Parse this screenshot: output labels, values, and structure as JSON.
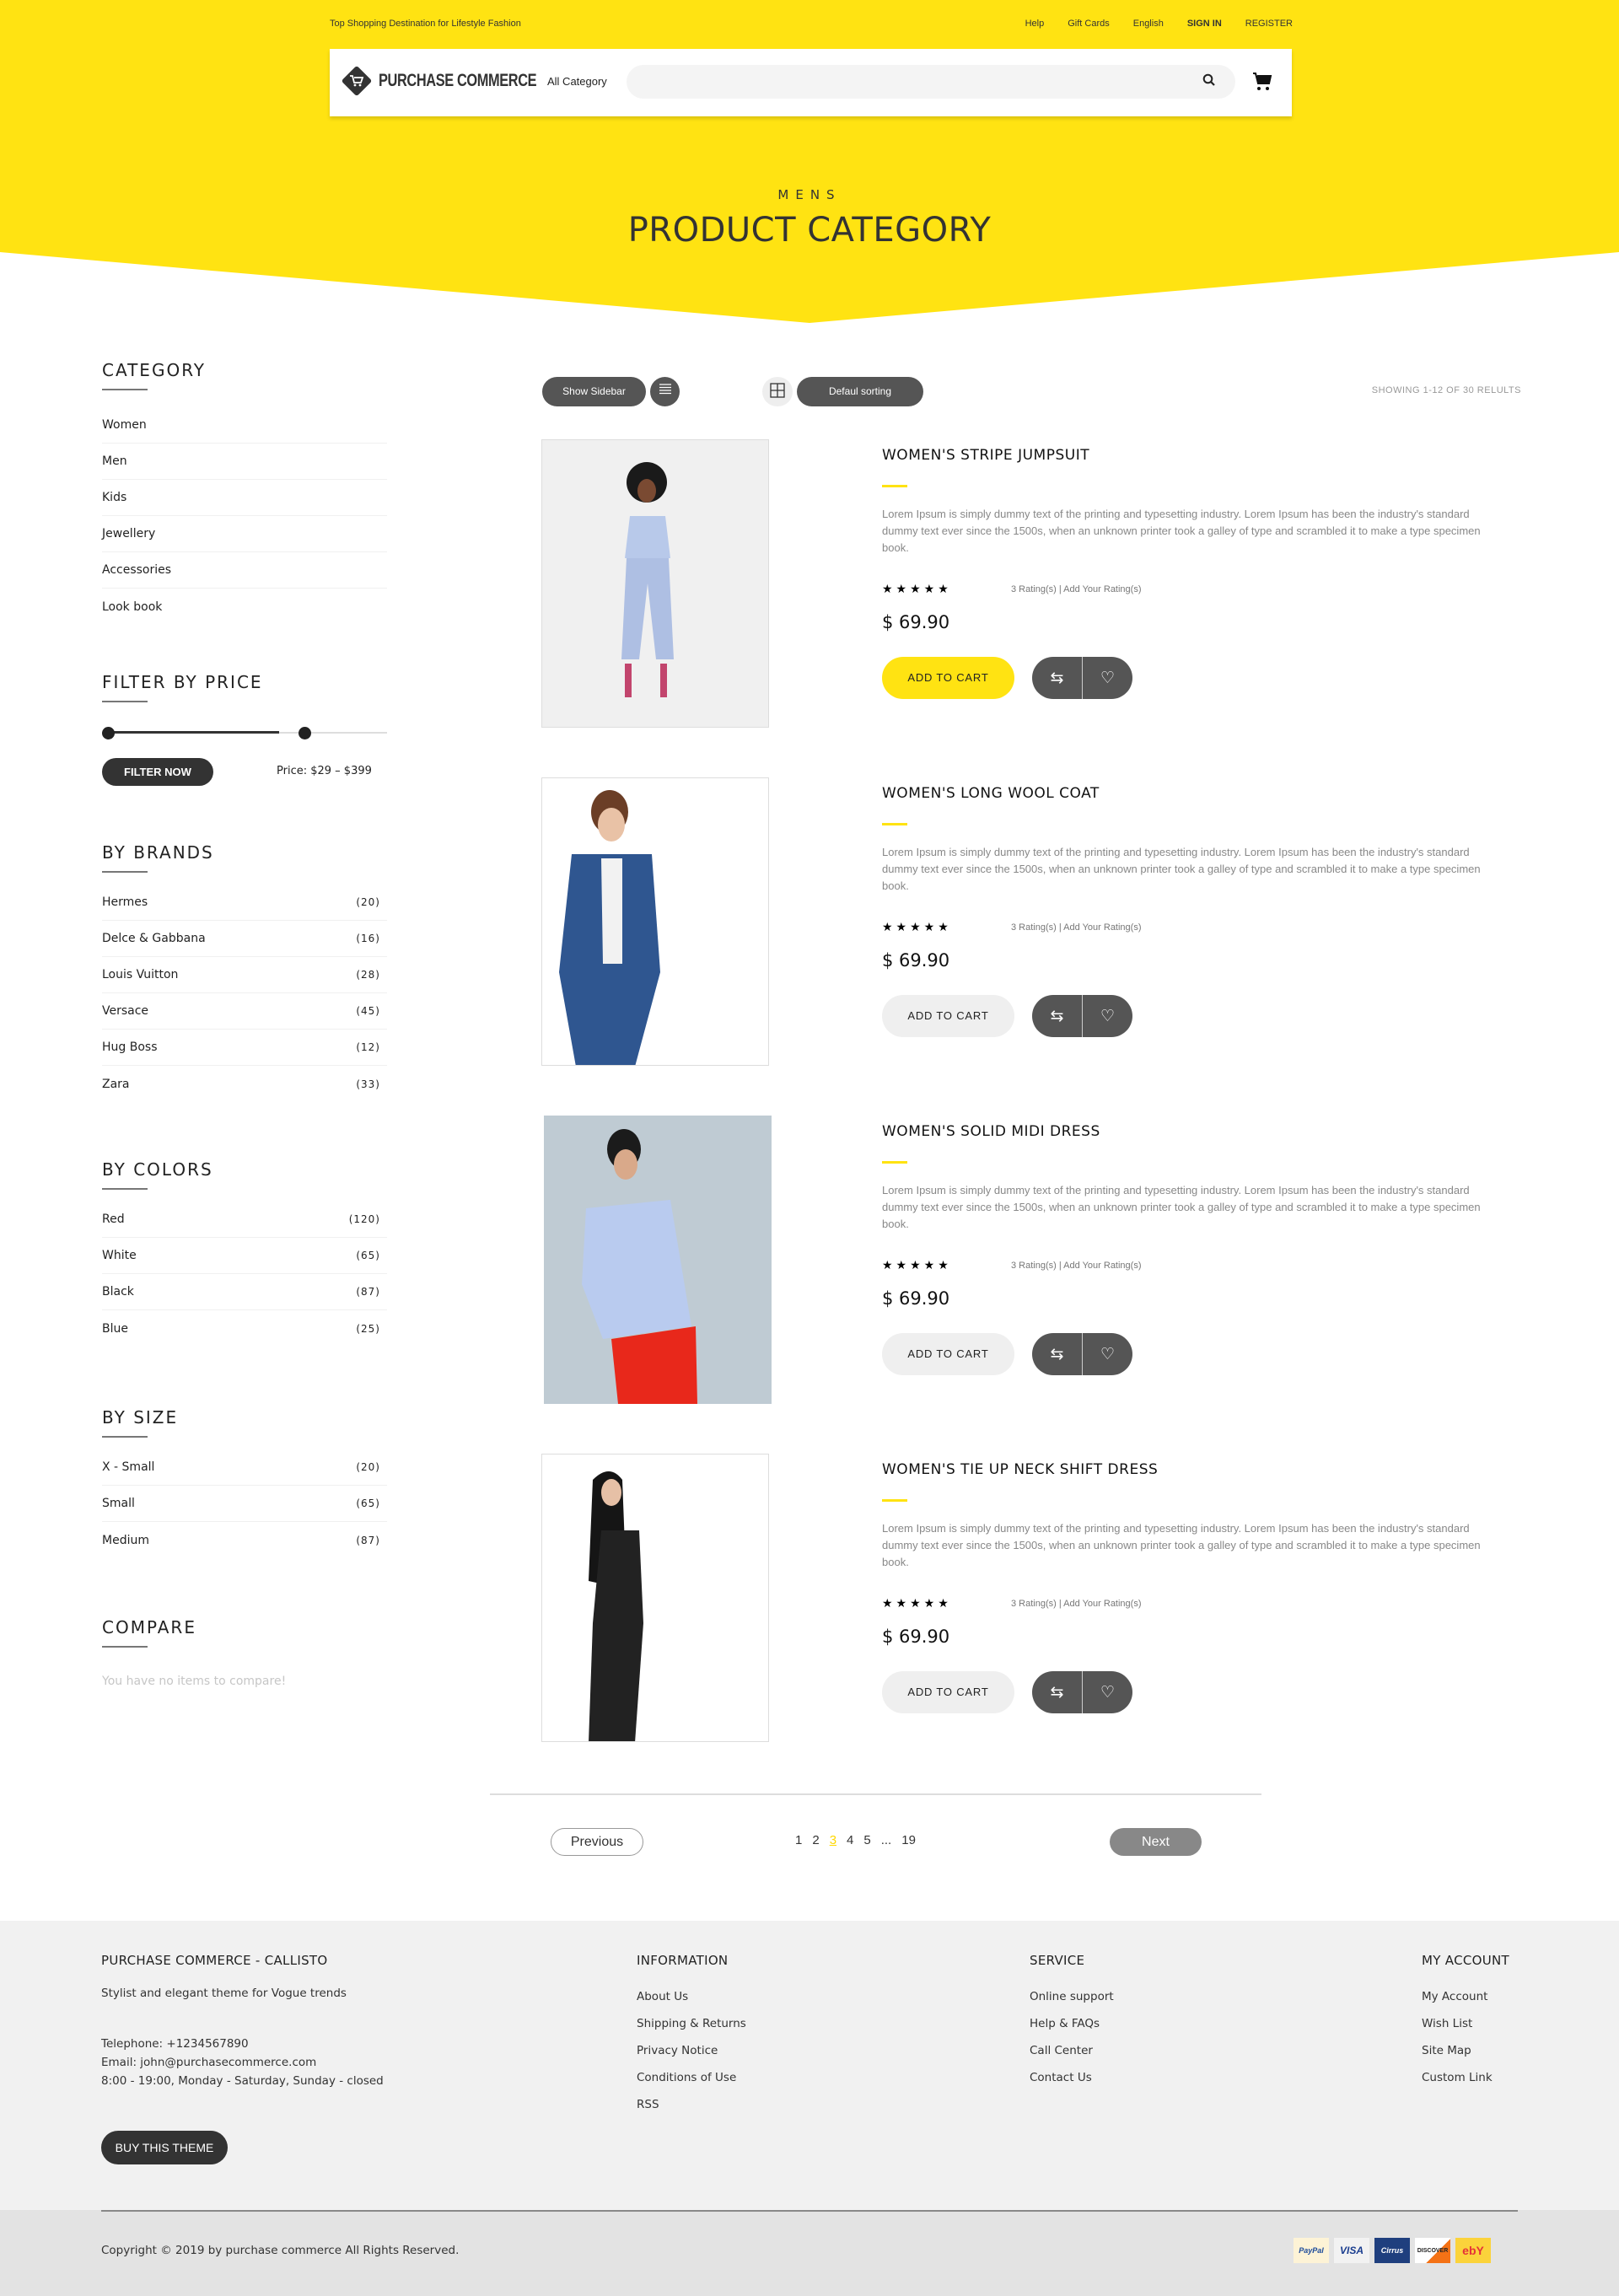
{
  "brand_color": "#ffe312",
  "topbar": {
    "tagline": "Top Shopping Destination for Lifestyle Fashion",
    "links": [
      "Help",
      "Gift Cards",
      "English",
      "SIGN IN",
      "REGISTER"
    ]
  },
  "header": {
    "logo_text": "PURCHASE COMMERCE",
    "category_select": "All Category",
    "search_placeholder": ""
  },
  "hero": {
    "subtitle": "MENS",
    "title": "PRODUCT CATEGORY"
  },
  "sidebar": {
    "category": {
      "title": "CATEGORY",
      "items": [
        "Women",
        "Men",
        "Kids",
        "Jewellery",
        "Accessories",
        "Look book"
      ]
    },
    "price": {
      "title": "FILTER BY PRICE",
      "button": "FILTER NOW",
      "label": "Price: $29 – $399",
      "range_min_fraction": 0.0,
      "range_max_fraction": 0.72
    },
    "brands": {
      "title": "BY BRANDS",
      "items": [
        {
          "name": "Hermes",
          "count": "(20)"
        },
        {
          "name": "Delce & Gabbana",
          "count": "(16)"
        },
        {
          "name": "Louis Vuitton",
          "count": "(28)"
        },
        {
          "name": "Versace",
          "count": "(45)"
        },
        {
          "name": "Hug Boss",
          "count": "(12)"
        },
        {
          "name": "Zara",
          "count": "(33)"
        }
      ]
    },
    "colors": {
      "title": "BY COLORS",
      "items": [
        {
          "name": "Red",
          "count": "(120)"
        },
        {
          "name": "White",
          "count": "(65)"
        },
        {
          "name": "Black",
          "count": "(87)"
        },
        {
          "name": "Blue",
          "count": "(25)"
        }
      ]
    },
    "size": {
      "title": "BY SIZE",
      "items": [
        {
          "name": "X - Small",
          "count": "(20)"
        },
        {
          "name": "Small",
          "count": "(65)"
        },
        {
          "name": "Medium",
          "count": "(87)"
        }
      ]
    },
    "compare": {
      "title": "COMPARE",
      "empty": "You have no items to compare!"
    }
  },
  "toolbar": {
    "show_sidebar": "Show Sidebar",
    "sorting": "Defaul sorting",
    "showing": "SHOWING 1-12 OF 30 RELULTS"
  },
  "products": [
    {
      "name": "WOMEN'S STRIPE JUMPSUIT",
      "desc": "Lorem Ipsum is simply dummy text of the printing and typesetting industry. Lorem Ipsum has been the industry's standard dummy text ever since the 1500s, when an unknown printer took a galley of type and scrambled it to make a type specimen book.",
      "stars": 5,
      "ratings": "3 Rating(s) | Add Your Rating(s)",
      "price": "$ 69.90",
      "add_to_cart": "ADD TO CART",
      "highlight": true
    },
    {
      "name": "WOMEN'S LONG WOOL COAT",
      "desc": "Lorem Ipsum is simply dummy text of the printing and typesetting industry. Lorem Ipsum has been the industry's standard dummy text ever since the 1500s, when an unknown printer took a galley of type and scrambled it to make a type specimen book.",
      "stars": 5,
      "ratings": "3 Rating(s) | Add Your Rating(s)",
      "price": "$ 69.90",
      "add_to_cart": "ADD TO CART",
      "highlight": false
    },
    {
      "name": "WOMEN'S SOLID MIDI DRESS",
      "desc": "Lorem Ipsum is simply dummy text of the printing and typesetting industry. Lorem Ipsum has been the industry's standard dummy text ever since the 1500s, when an unknown printer took a galley of type and scrambled it to make a type specimen book.",
      "stars": 5,
      "ratings": "3 Rating(s) | Add Your Rating(s)",
      "price": "$ 69.90",
      "add_to_cart": "ADD TO CART",
      "highlight": false
    },
    {
      "name": "WOMEN'S TIE UP NECK SHIFT DRESS",
      "desc": "Lorem Ipsum is simply dummy text of the printing and typesetting industry. Lorem Ipsum has been the industry's standard dummy text ever since the 1500s, when an unknown printer took a galley of type and scrambled it to make a type specimen book.",
      "stars": 5,
      "ratings": "3 Rating(s) | Add Your Rating(s)",
      "price": "$ 69.90",
      "add_to_cart": "ADD TO CART",
      "highlight": false
    }
  ],
  "pagination": {
    "previous": "Previous",
    "next": "Next",
    "pages": [
      "1",
      "2",
      "3",
      "4",
      "5",
      "...",
      "19"
    ],
    "current": "3"
  },
  "footer": {
    "about": {
      "title": "PURCHASE COMMERCE - CALLISTO",
      "tagline": "Stylist and elegant theme for Vogue trends",
      "telephone": "Telephone: +1234567890",
      "email": "Email: john@purchasecommerce.com",
      "hours": "8:00 - 19:00, Monday - Saturday, Sunday - closed",
      "button": "BUY THIS THEME"
    },
    "information": {
      "title": "INFORMATION",
      "links": [
        "About Us",
        "Shipping & Returns",
        "Privacy Notice",
        "Conditions of Use",
        "RSS"
      ]
    },
    "service": {
      "title": "SERVICE",
      "links": [
        "Online support",
        "Help & FAQs",
        "Call Center",
        "Contact Us"
      ]
    },
    "account": {
      "title": "MY ACCOUNT",
      "links": [
        "My Account",
        "Wish List",
        "Site Map",
        "Custom Link"
      ]
    },
    "copyright": "Copyright © 2019 by purchase commerce All Rights Reserved.",
    "payments": [
      "PayPal",
      "VISA",
      "Cirrus",
      "DISCOVER",
      "ebY"
    ]
  }
}
